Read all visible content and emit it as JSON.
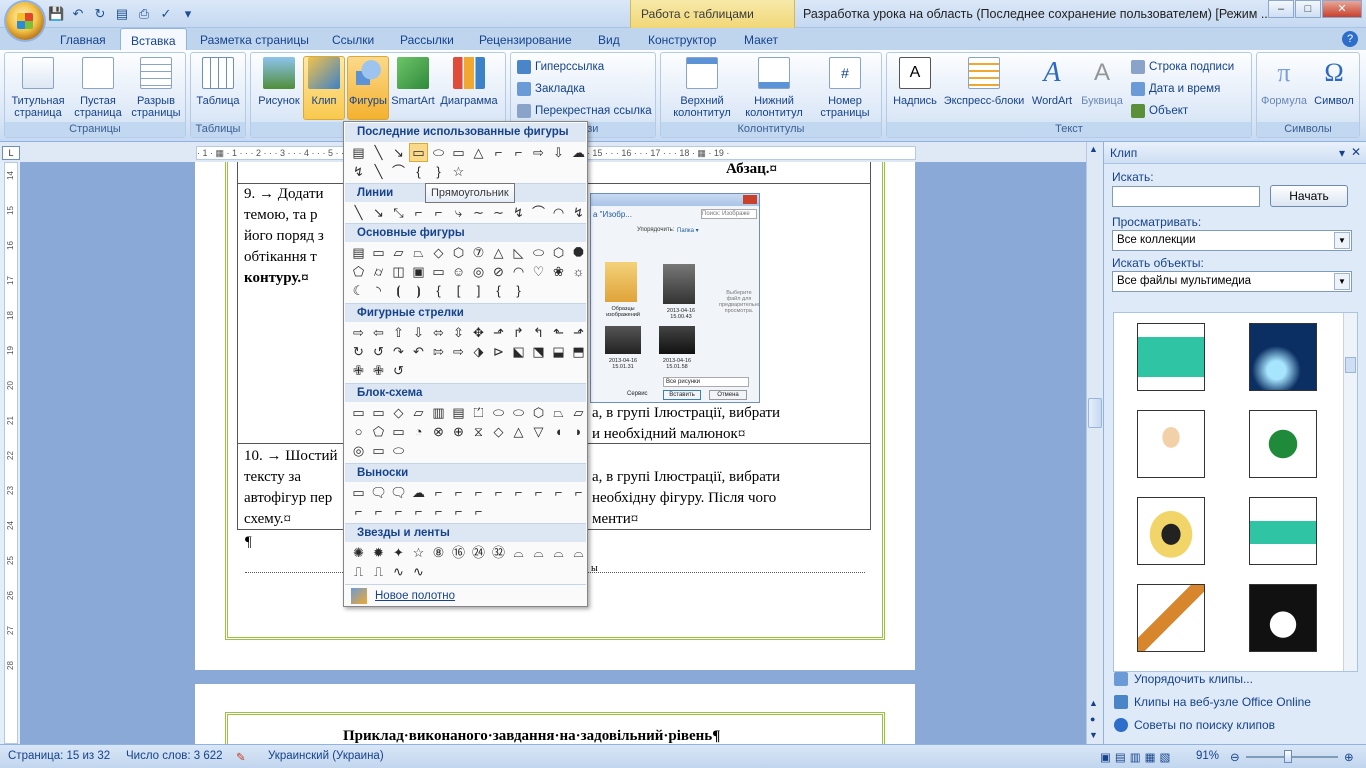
{
  "window": {
    "title": "Разработка урока на область (Последнее сохранение пользователем) [Режим ...",
    "context_tab": "Работа с таблицами",
    "controls": [
      "–",
      "□",
      "✕"
    ]
  },
  "tabs": [
    "Главная",
    "Вставка",
    "Разметка страницы",
    "Ссылки",
    "Рассылки",
    "Рецензирование",
    "Вид",
    "Конструктор",
    "Макет"
  ],
  "ribbon": {
    "groups": {
      "pages": "Страницы",
      "tables": "Таблицы",
      "illustrations": "Иллюстрации",
      "links": "Связи",
      "headers": "Колонтитулы",
      "text": "Текст",
      "symbols": "Символы"
    },
    "buttons": {
      "cover_page": "Титульная страница",
      "blank_page": "Пустая страница",
      "page_break": "Разрыв страницы",
      "table": "Таблица",
      "picture": "Рисунок",
      "clip": "Клип",
      "shapes": "Фигуры",
      "smartart": "SmartArt",
      "chart": "Диаграмма",
      "hyperlink": "Гиперссылка",
      "bookmark": "Закладка",
      "cross_ref": "Перекрестная ссылка",
      "header": "Верхний колонтитул",
      "footer": "Нижний колонтитул",
      "page_number": "Номер страницы",
      "textbox": "Надпись",
      "quick_parts": "Экспресс-блоки",
      "wordart": "WordArt",
      "dropcap": "Буквица",
      "signature_line": "Строка подписи",
      "date_time": "Дата и время",
      "object": "Объект",
      "equation": "Формула",
      "symbol": "Символ"
    }
  },
  "ruler": {
    "h_ticks": "· 1 · ▦ · 1 · · · 2 · · · 3 · · · 4 · · · 5 · · · 6 · · · 7 · · · 8 · · · 9 · · · 10 · · · 11 · · · 12 · · · 13 · · · 14 · · · 15 · · · 16 · · · 17 · · · 18 · ▦ · 19 ·",
    "v_ticks": [
      "14",
      "15",
      "16",
      "17",
      "18",
      "19",
      "20",
      "21",
      "22",
      "23",
      "24",
      "25",
      "26",
      "27",
      "28"
    ],
    "corner": "L"
  },
  "document": {
    "cell_top_right": "Абзац.¤",
    "row9": {
      "line1": "9. → Додати",
      "line2": "темою, та р",
      "line3": "його поряд з",
      "line4": "обтікання т",
      "line5": "контуру.¤",
      "right1": "а, в групі Ілюстрації, вибрати",
      "right2": "и необхідний малюнок¤"
    },
    "row10": {
      "line1": "10. → Шостий",
      "line2": "тексту за",
      "line3": "автофігур пер",
      "line4": "схему.¤",
      "right1": "а, в групі Ілюстрації, вибрати",
      "right2": "необхідну фігуру. Після чого",
      "right3": "менти¤"
    },
    "pilcrow": "¶",
    "section_break": "ы",
    "page2_heading": "Приклад·виконаного·завдання·на·задовільний·рівень¶"
  },
  "shapes_menu": {
    "sections": {
      "recent": "Последние использованные фигуры",
      "lines": "Линии",
      "basic": "Основные фигуры",
      "arrows": "Фигурные стрелки",
      "flowchart": "Блок-схема",
      "callouts": "Выноски",
      "stars": "Звезды и ленты"
    },
    "rows": {
      "recent1": [
        "▤",
        "╲",
        "↘",
        "▭",
        "⬭",
        "▭",
        "△",
        "⌐",
        "⌐",
        "⇨",
        "⇩",
        "☁"
      ],
      "recent2": [
        "↯",
        "╲",
        "⌒",
        "{",
        "}",
        "☆"
      ],
      "lines": [
        "╲",
        "↘",
        "⤡",
        "⌐",
        "⌐",
        "⤷",
        "∼",
        "∼",
        "↯",
        "⌒",
        "◠",
        "↯"
      ],
      "basic1": [
        "▤",
        "▭",
        "▱",
        "⏢",
        "◇",
        "⬡",
        "⑦",
        "△",
        "◺",
        "⬭",
        "⬡",
        "⯃"
      ],
      "basic2": [
        "⬠",
        "⌭",
        "◫",
        "▣",
        "▭",
        "☺",
        "◎",
        "⊘",
        "◠",
        "♡",
        "❀",
        "☼"
      ],
      "basic3": [
        "☾",
        "◝",
        "⦗",
        "⦘",
        "{",
        "[",
        "]",
        "{",
        "}"
      ],
      "arrows1": [
        "⇨",
        "⇦",
        "⇧",
        "⇩",
        "⬄",
        "⇳",
        "✥",
        "⬏",
        "↱",
        "↰",
        "⬑",
        "⬏"
      ],
      "arrows2": [
        "↻",
        "↺",
        "↷",
        "↶",
        "⇰",
        "⇨",
        "⬗",
        "⊳",
        "⬕",
        "⬔",
        "⬓",
        "⬒"
      ],
      "arrows3": [
        "✙",
        "✙",
        "↺"
      ],
      "flow1": [
        "▭",
        "▭",
        "◇",
        "▱",
        "▥",
        "▤",
        "⏍",
        "⬭",
        "⬭",
        "⬡",
        "⏢",
        "⏥"
      ],
      "flow2": [
        "○",
        "⬠",
        "▭",
        "◔",
        "⊗",
        "⊕",
        "⧖",
        "◇",
        "△",
        "▽",
        "◖",
        "◗"
      ],
      "flow3": [
        "◎",
        "▭",
        "⬭"
      ],
      "callouts1": [
        "▭",
        "🗨",
        "🗨",
        "☁",
        "⌐",
        "⌐",
        "⌐",
        "⌐",
        "⌐",
        "⌐",
        "⌐",
        "⌐"
      ],
      "callouts2": [
        "⌐",
        "⌐",
        "⌐",
        "⌐",
        "⌐",
        "⌐",
        "⌐"
      ],
      "stars1": [
        "✺",
        "✹",
        "✦",
        "☆",
        "⑧",
        "⑯",
        "㉔",
        "㉜",
        "⌓",
        "⌓",
        "⌓",
        "⌓"
      ],
      "stars2": [
        "⎍",
        "⎍",
        "∿",
        "∿"
      ]
    },
    "tooltip": "Прямоугольник",
    "new_canvas": "Новое полотно"
  },
  "embedded_window": {
    "breadcrumb": "а \"Изобр...",
    "search": "Поиск: Изображе",
    "arrange": "Упорядочить:",
    "arrange_val": "Папка ▾",
    "items": [
      "Образцы изображений",
      "2013-04-16 15.00.43",
      "2013-04-16 15.01.31",
      "2013-04-16 15.01.58"
    ],
    "preview": "Выберите файл для предварительного просмотра.",
    "filter": "Все рисунки",
    "service": "Сервис",
    "insert": "Вставить",
    "cancel": "Отмена"
  },
  "clip_pane": {
    "title": "Клип",
    "search_label": "Искать:",
    "search_value": "",
    "go_button": "Начать",
    "browse_label": "Просматривать:",
    "browse_value": "Все коллекции",
    "types_label": "Искать объекты:",
    "types_value": "Все файлы мультимедиа",
    "links": [
      "Упорядочить клипы...",
      "Клипы на веб-узле Office Online",
      "Советы по поиску клипов"
    ]
  },
  "status": {
    "page": "Страница: 15 из 32",
    "words": "Число слов: 3 622",
    "language": "Украинский (Украина)",
    "zoom": "91%",
    "zoom_value": 0.91
  },
  "colors": {
    "ribbon_accent": "#15428b",
    "hot_button": "#f9c94e",
    "page_border": "#9ac43c"
  }
}
